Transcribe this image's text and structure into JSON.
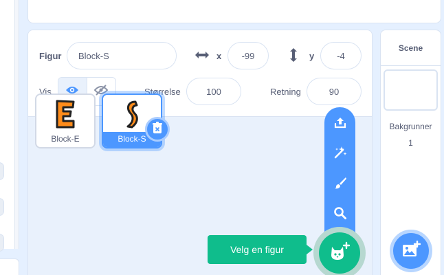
{
  "colors": {
    "accent": "#4c97ff",
    "add_sprite": "#0fbd8c",
    "pane_bg": "#e9f1fc"
  },
  "sprite_info": {
    "sprite_label": "Figur",
    "sprite_name": "Block-S",
    "x_label": "x",
    "x_value": "-99",
    "y_label": "y",
    "y_value": "-4",
    "show_label": "Vis",
    "size_label": "Størrelse",
    "size_value": "100",
    "direction_label": "Retning",
    "direction_value": "90",
    "icons": {
      "x": "horizontal-arrows-icon",
      "y": "vertical-arrows-icon",
      "show": "eye-icon",
      "hide": "eye-slash-icon"
    }
  },
  "sprites": [
    {
      "name": "Block-E",
      "glyph": "E",
      "selected": false
    },
    {
      "name": "Block-S",
      "glyph": "S",
      "selected": true
    }
  ],
  "sprite_menu": {
    "tooltip": "Velg en figur",
    "items": [
      "upload-icon",
      "surprise-icon",
      "paint-icon",
      "search-icon"
    ],
    "main_icon": "cat-plus-icon"
  },
  "scene": {
    "title": "Scene",
    "backdrops_label": "Bakgrunner",
    "backdrops_count": "1",
    "add_backdrop_icon": "picture-plus-icon"
  }
}
